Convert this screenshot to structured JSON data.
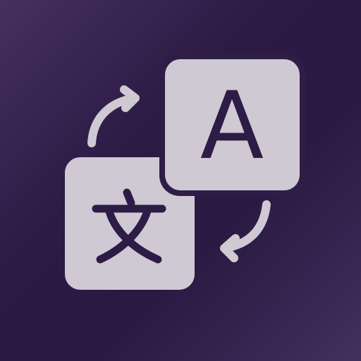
{
  "icon": {
    "name": "translate-icon",
    "tile_front_glyph": "A",
    "tile_back_glyph": "文",
    "colors": {
      "background_light": "#46305f",
      "background_dark": "#2a1942",
      "tile": "#cfc9d3",
      "glyph": "#2d1c46"
    }
  }
}
